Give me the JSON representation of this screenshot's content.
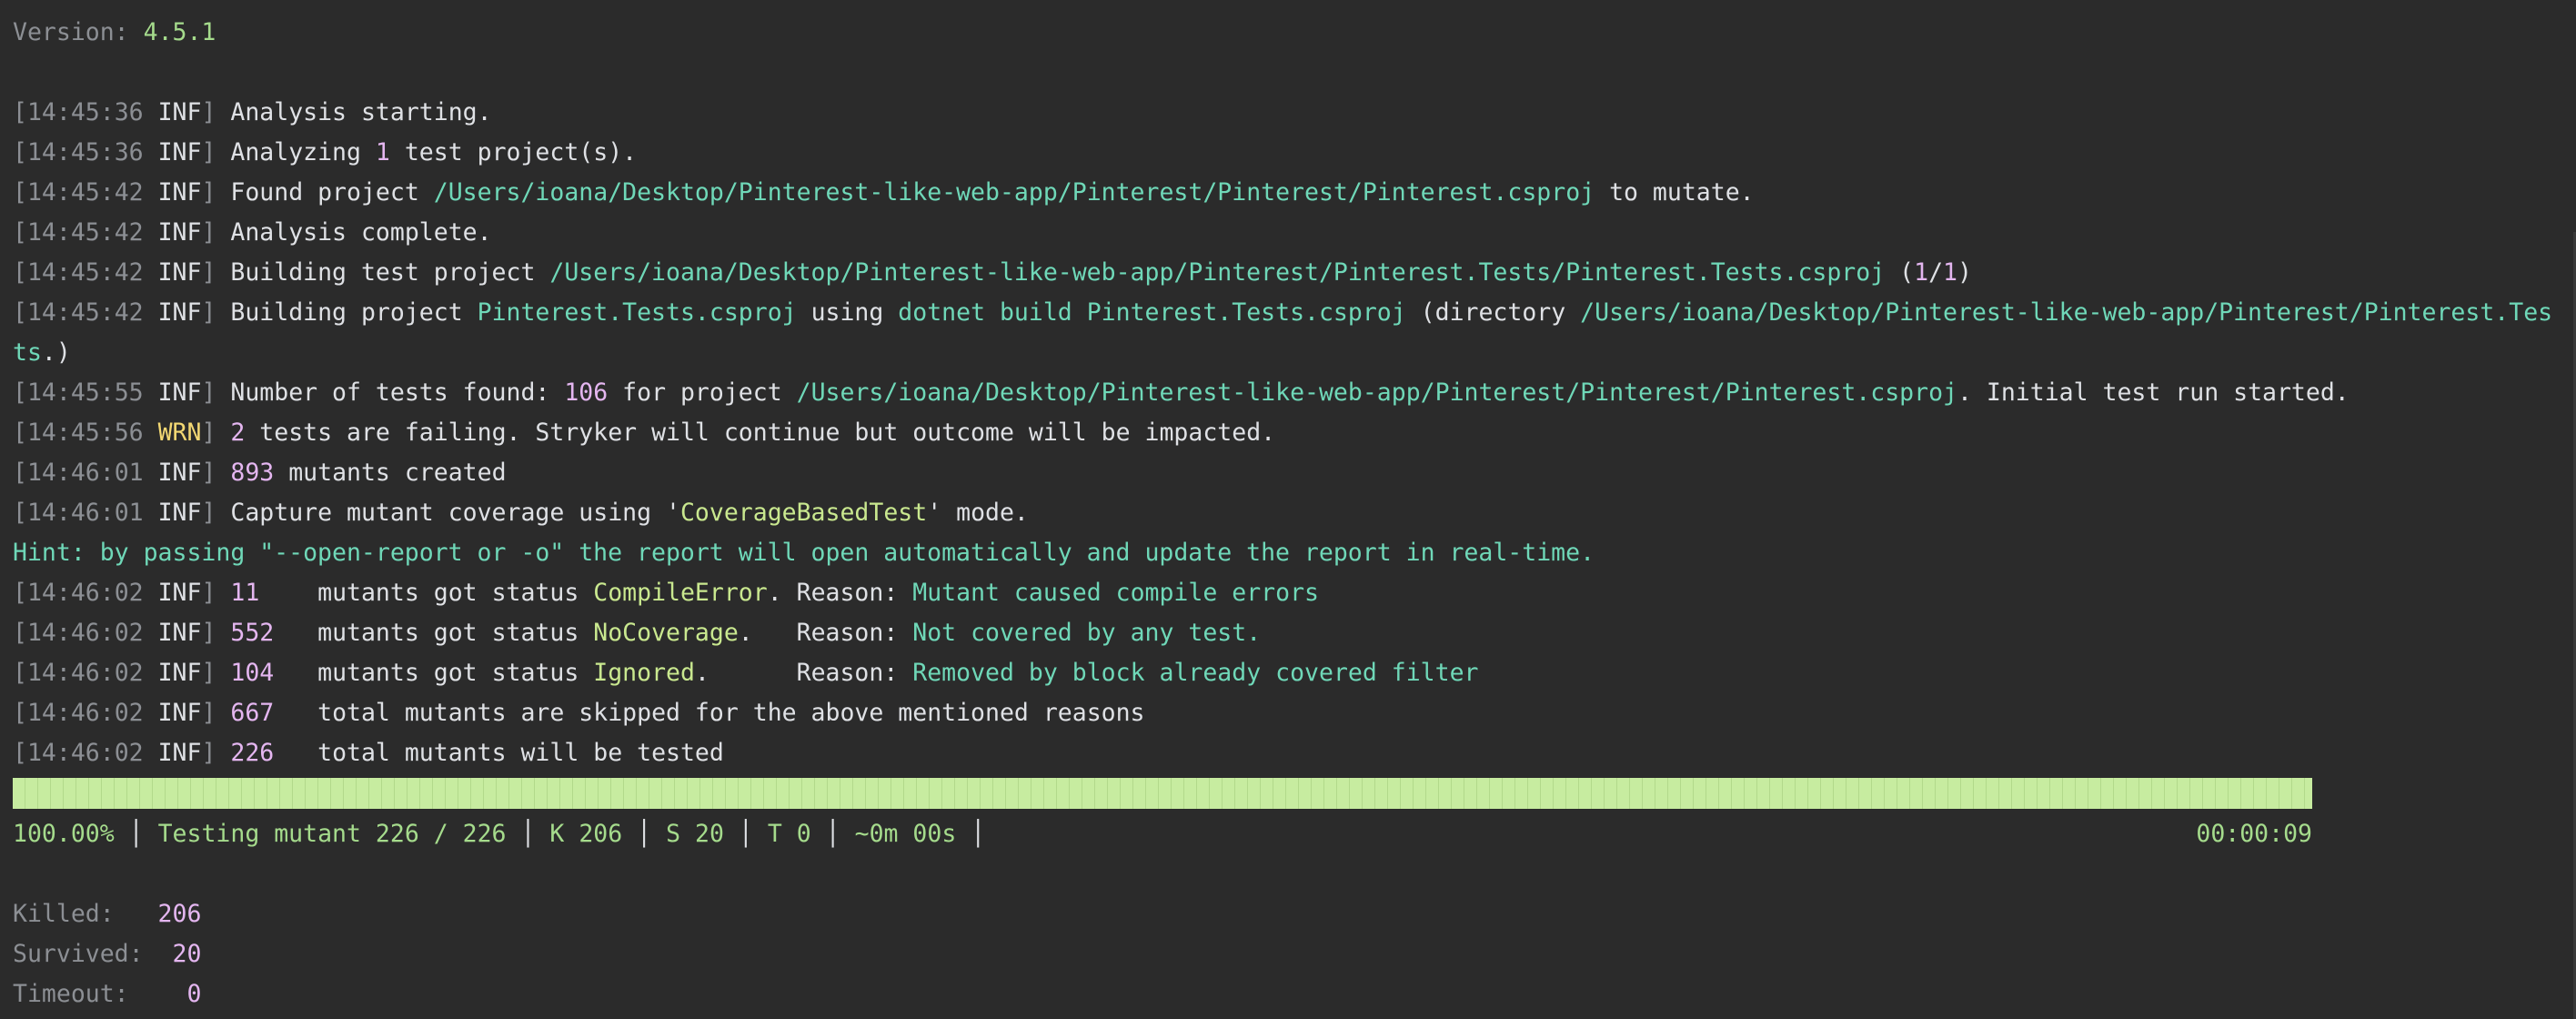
{
  "header": {
    "version_label": "Version:",
    "version_value": "4.5.1"
  },
  "log": [
    {
      "time": "14:45:36",
      "level": "INF",
      "parts": [
        {
          "t": "Analysis starting.",
          "c": "white"
        }
      ]
    },
    {
      "time": "14:45:36",
      "level": "INF",
      "parts": [
        {
          "t": "Analyzing ",
          "c": "white"
        },
        {
          "t": "1",
          "c": "purple"
        },
        {
          "t": " test project(s).",
          "c": "white"
        }
      ]
    },
    {
      "time": "14:45:42",
      "level": "INF",
      "parts": [
        {
          "t": "Found project ",
          "c": "white"
        },
        {
          "t": "/Users/ioana/Desktop/Pinterest-like-web-app/Pinterest/Pinterest/Pinterest.csproj",
          "c": "teal"
        },
        {
          "t": " to mutate.",
          "c": "white"
        }
      ]
    },
    {
      "time": "14:45:42",
      "level": "INF",
      "parts": [
        {
          "t": "Analysis complete.",
          "c": "white"
        }
      ]
    },
    {
      "time": "14:45:42",
      "level": "INF",
      "parts": [
        {
          "t": "Building test project ",
          "c": "white"
        },
        {
          "t": "/Users/ioana/Desktop/Pinterest-like-web-app/Pinterest/Pinterest.Tests/Pinterest.Tests.csproj",
          "c": "teal"
        },
        {
          "t": " (",
          "c": "white"
        },
        {
          "t": "1",
          "c": "purple"
        },
        {
          "t": "/",
          "c": "white"
        },
        {
          "t": "1",
          "c": "purple"
        },
        {
          "t": ")",
          "c": "white"
        }
      ]
    },
    {
      "time": "14:45:42",
      "level": "INF",
      "parts": [
        {
          "t": "Building project ",
          "c": "white"
        },
        {
          "t": "Pinterest.Tests.csproj",
          "c": "teal"
        },
        {
          "t": " using ",
          "c": "white"
        },
        {
          "t": "dotnet build Pinterest.Tests.csproj",
          "c": "teal"
        },
        {
          "t": " (directory ",
          "c": "white"
        },
        {
          "t": "/Users/ioana/Desktop/Pinterest-like-web-app/Pinterest/Pinterest.Tes",
          "c": "teal"
        }
      ]
    },
    {
      "time": "",
      "level": "",
      "parts": [
        {
          "t": "ts",
          "c": "teal"
        },
        {
          "t": ".)",
          "c": "white"
        }
      ]
    },
    {
      "time": "14:45:55",
      "level": "INF",
      "parts": [
        {
          "t": "Number of tests found: ",
          "c": "white"
        },
        {
          "t": "106",
          "c": "purple"
        },
        {
          "t": " for project ",
          "c": "white"
        },
        {
          "t": "/Users/ioana/Desktop/Pinterest-like-web-app/Pinterest/Pinterest/Pinterest.csproj",
          "c": "teal"
        },
        {
          "t": ". Initial test run started.",
          "c": "white"
        }
      ]
    },
    {
      "time": "14:45:56",
      "level": "WRN",
      "parts": [
        {
          "t": "2",
          "c": "purple"
        },
        {
          "t": " tests are failing. Stryker will continue but outcome will be impacted.",
          "c": "white"
        }
      ]
    },
    {
      "time": "14:46:01",
      "level": "INF",
      "parts": [
        {
          "t": "893",
          "c": "purple"
        },
        {
          "t": " mutants created",
          "c": "white"
        }
      ]
    },
    {
      "time": "14:46:01",
      "level": "INF",
      "parts": [
        {
          "t": "Capture mutant coverage using '",
          "c": "white"
        },
        {
          "t": "CoverageBasedTest",
          "c": "lime"
        },
        {
          "t": "' mode.",
          "c": "white"
        }
      ]
    },
    {
      "time": "",
      "level": "",
      "parts": [
        {
          "t": "Hint: by passing \"--open-report or -o\" the report will open automatically and update the report in real-time.",
          "c": "hint"
        }
      ]
    },
    {
      "time": "14:46:02",
      "level": "INF",
      "parts": [
        {
          "t": "11",
          "c": "purple"
        },
        {
          "t": "    mutants got status ",
          "c": "white"
        },
        {
          "t": "CompileError",
          "c": "lime"
        },
        {
          "t": ". Reason: ",
          "c": "white"
        },
        {
          "t": "Mutant caused compile errors",
          "c": "teal"
        }
      ]
    },
    {
      "time": "14:46:02",
      "level": "INF",
      "parts": [
        {
          "t": "552",
          "c": "purple"
        },
        {
          "t": "   mutants got status ",
          "c": "white"
        },
        {
          "t": "NoCoverage",
          "c": "lime"
        },
        {
          "t": ".   Reason: ",
          "c": "white"
        },
        {
          "t": "Not covered by any test.",
          "c": "teal"
        }
      ]
    },
    {
      "time": "14:46:02",
      "level": "INF",
      "parts": [
        {
          "t": "104",
          "c": "purple"
        },
        {
          "t": "   mutants got status ",
          "c": "white"
        },
        {
          "t": "Ignored",
          "c": "lime"
        },
        {
          "t": ".      Reason: ",
          "c": "white"
        },
        {
          "t": "Removed by block already covered filter",
          "c": "teal"
        }
      ]
    },
    {
      "time": "14:46:02",
      "level": "INF",
      "parts": [
        {
          "t": "667",
          "c": "purple"
        },
        {
          "t": "   total mutants are skipped for the above mentioned reasons",
          "c": "white"
        }
      ]
    },
    {
      "time": "14:46:02",
      "level": "INF",
      "parts": [
        {
          "t": "226",
          "c": "purple"
        },
        {
          "t": "   total mutants will be tested",
          "c": "white"
        }
      ]
    }
  ],
  "progress": {
    "percent": "100.00%",
    "fraction": 1.0,
    "testing": "Testing mutant 226 / 226",
    "killed": "K 206",
    "survived": "S 20",
    "timeout": "T 0",
    "eta": "~0m 00s",
    "separator": "│",
    "elapsed": "00:00:09"
  },
  "summary": [
    {
      "label": "Killed:  ",
      "value": " 206"
    },
    {
      "label": "Survived:",
      "value": "  20"
    },
    {
      "label": "Timeout: ",
      "value": "   0"
    }
  ],
  "colors": {
    "background": "#2b2b2b",
    "text": "#dfe1e5",
    "dim": "#8c8f94",
    "path": "#6fd8b8",
    "number": "#e4b6f0",
    "warning": "#f3d873",
    "status": "#c9e88f",
    "progress": "#c7eca0"
  }
}
